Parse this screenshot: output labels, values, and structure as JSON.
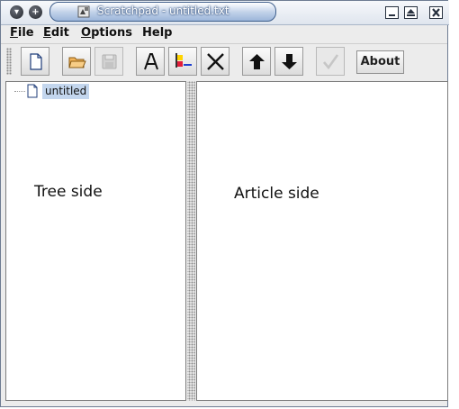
{
  "window": {
    "title": "Scratchpad - untitled.txt"
  },
  "menubar": {
    "items": [
      {
        "label": "File",
        "mnemonic": "F",
        "rest": "ile"
      },
      {
        "label": "Edit",
        "mnemonic": "E",
        "rest": "dit"
      },
      {
        "label": "Options",
        "mnemonic": "O",
        "rest": "ptions"
      },
      {
        "label": "Help",
        "mnemonic": "",
        "rest": "Help"
      }
    ]
  },
  "toolbar": {
    "buttons": [
      {
        "icon": "new-file-icon",
        "enabled": true
      },
      {
        "icon": "open-folder-icon",
        "enabled": true
      },
      {
        "icon": "save-disk-icon",
        "enabled": false
      },
      {
        "icon": "font-a-icon",
        "enabled": true
      },
      {
        "icon": "colors-icon",
        "enabled": true
      },
      {
        "icon": "delete-x-icon",
        "enabled": true
      },
      {
        "icon": "move-up-arrow-icon",
        "enabled": true
      },
      {
        "icon": "move-down-arrow-icon",
        "enabled": true
      },
      {
        "icon": "checkmark-icon",
        "enabled": false
      }
    ],
    "about_label": "About"
  },
  "tree": {
    "nodes": [
      {
        "label": "untitled",
        "icon": "document-icon",
        "selected": true
      }
    ]
  },
  "panels": {
    "left_caption": "Tree side",
    "right_caption": "Article side"
  },
  "colors": {
    "selection": "#c3d6ee",
    "title_accent": "#9db6da"
  }
}
